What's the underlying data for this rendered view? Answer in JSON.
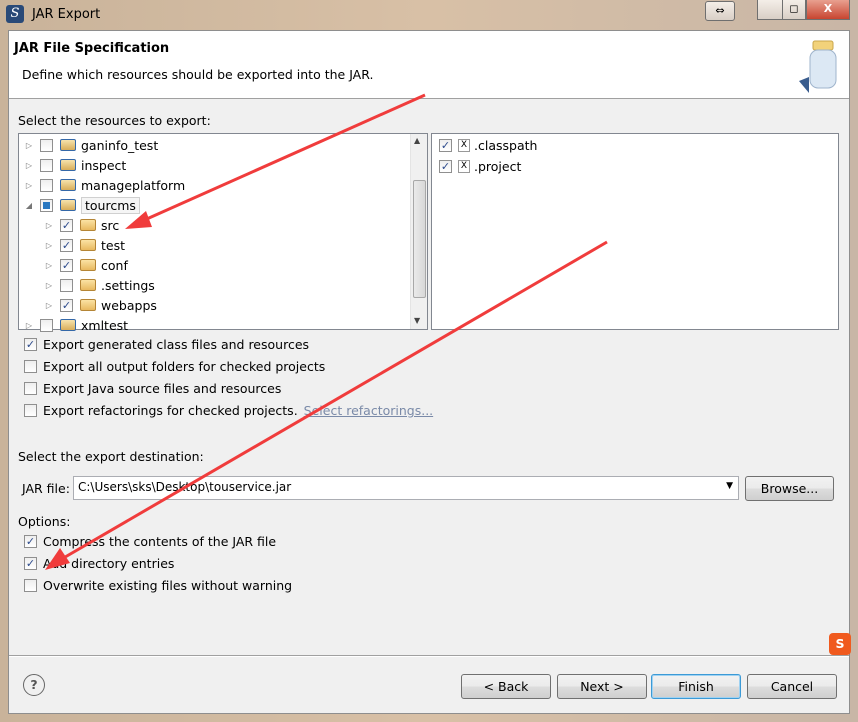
{
  "window": {
    "title": "JAR Export",
    "controls": [
      "⇔",
      "▭",
      "◻",
      "X"
    ]
  },
  "header": {
    "title": "JAR File Specification",
    "description": "Define which resources should be exported into the JAR."
  },
  "resources": {
    "label": "Select the resources to export:",
    "tree": [
      {
        "label": "ganinfo_test",
        "level": 0,
        "checked": "unchecked",
        "icon": "project-error-icon"
      },
      {
        "label": "inspect",
        "level": 0,
        "checked": "unchecked",
        "icon": "project-error-icon"
      },
      {
        "label": "manageplatform",
        "level": 0,
        "checked": "unchecked",
        "icon": "project-warning-icon"
      },
      {
        "label": "tourcms",
        "level": 0,
        "checked": "partial",
        "expanded": true,
        "icon": "project-warning-icon"
      },
      {
        "label": "src",
        "level": 1,
        "checked": "checked",
        "icon": "package-folder-warning-icon"
      },
      {
        "label": "test",
        "level": 1,
        "checked": "checked",
        "icon": "package-folder-warning-icon"
      },
      {
        "label": "conf",
        "level": 1,
        "checked": "checked",
        "icon": "package-folder-icon"
      },
      {
        "label": ".settings",
        "level": 1,
        "checked": "unchecked",
        "icon": "folder-icon"
      },
      {
        "label": "webapps",
        "level": 1,
        "checked": "checked",
        "icon": "folder-icon"
      },
      {
        "label": "xmltest",
        "level": 0,
        "checked": "unchecked",
        "icon": "project-warning-icon"
      }
    ],
    "files": [
      {
        "label": ".classpath",
        "checked": true
      },
      {
        "label": ".project",
        "checked": true
      }
    ]
  },
  "export_options": [
    {
      "label": "Export generated class files and resources",
      "checked": true
    },
    {
      "label": "Export all output folders for checked projects",
      "checked": false
    },
    {
      "label": "Export Java source files and resources",
      "checked": false
    },
    {
      "label": "Export refactorings for checked projects.",
      "checked": false,
      "link": "Select refactorings..."
    }
  ],
  "destination": {
    "label": "Select the export destination:",
    "jar_label": "JAR file:",
    "jar_value": "C:\\Users\\sks\\Desktop\\touservice.jar",
    "browse": "Browse..."
  },
  "options": {
    "label": "Options:",
    "items": [
      {
        "label": "Compress the contents of the JAR file",
        "checked": true
      },
      {
        "label": "Add directory entries",
        "checked": true
      },
      {
        "label": "Overwrite existing files without warning",
        "checked": false
      }
    ]
  },
  "buttons": {
    "back": "< Back",
    "next": "Next >",
    "finish": "Finish",
    "cancel": "Cancel",
    "help": "?"
  },
  "colors": {
    "annotation_arrow": "#f03c3c",
    "finish_border": "#3c9ad6"
  }
}
